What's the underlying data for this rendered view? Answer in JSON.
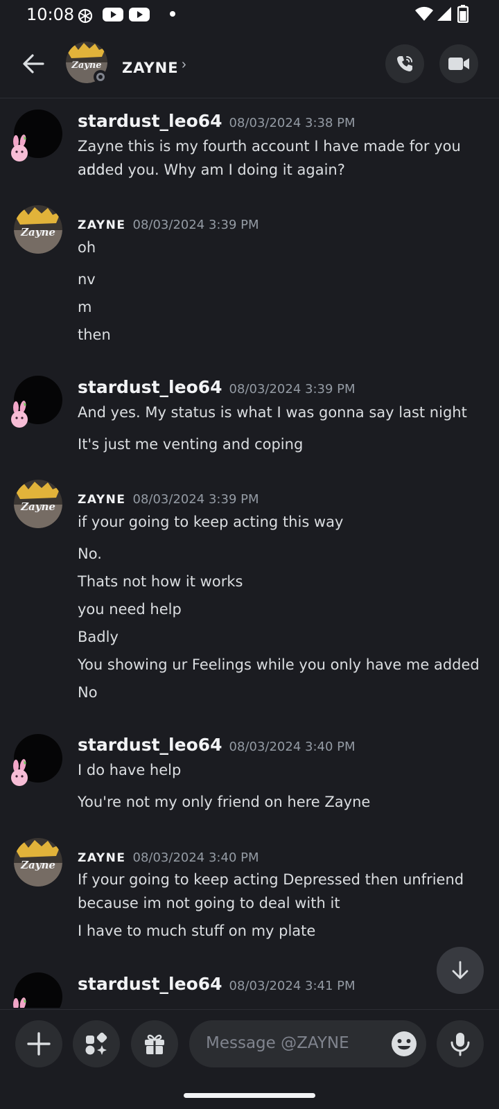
{
  "status_bar": {
    "time": "10:08"
  },
  "header": {
    "title": "ZAYNE",
    "chevron": "›"
  },
  "messages": [
    {
      "author": "stardust_leo64",
      "timestamp": "08/03/2024 3:38 PM",
      "lines": [
        "Zayne this is my fourth account I have made for you and",
        "added you. Why am I doing it again?"
      ]
    },
    {
      "author": "ZAYNE",
      "timestamp": "08/03/2024 3:39 PM",
      "lines": [
        "oh",
        "nv",
        "m",
        "then"
      ]
    },
    {
      "author": "stardust_leo64",
      "timestamp": "08/03/2024 3:39 PM",
      "lines": [
        "And yes. My status is what I was gonna say last night",
        "It's just me venting and coping"
      ]
    },
    {
      "author": "ZAYNE",
      "timestamp": "08/03/2024 3:39 PM",
      "lines": [
        "if your going to keep acting this way",
        "No.",
        "Thats not how it works",
        "you need help",
        "Badly",
        "You showing ur Feelings while you only have me added",
        "No"
      ]
    },
    {
      "author": "stardust_leo64",
      "timestamp": "08/03/2024 3:40 PM",
      "lines": [
        "I do have help",
        "You're not my only friend on here Zayne"
      ]
    },
    {
      "author": "ZAYNE",
      "timestamp": "08/03/2024 3:40 PM",
      "lines": [
        "If your going to keep acting Depressed then unfriend",
        "because im not going to deal with it",
        "I have to much stuff on my plate"
      ]
    },
    {
      "author": "stardust_leo64",
      "timestamp": "08/03/2024 3:41 PM",
      "lines": []
    }
  ],
  "input": {
    "placeholder": "Message @ZAYNE"
  },
  "avatar_label": "Zayne",
  "icons": {
    "back": "arrow-left-icon",
    "call": "phone-call-icon",
    "video": "video-camera-icon",
    "add": "plus-icon",
    "apps": "apps-icon",
    "gift": "gift-icon",
    "emoji": "emoji-icon",
    "mic": "microphone-icon",
    "scroll": "arrow-down-icon"
  },
  "colors": {
    "background": "#1b1c21",
    "surface": "#2b2d31",
    "muted": "#949ba4",
    "text": "#dbdee1"
  }
}
